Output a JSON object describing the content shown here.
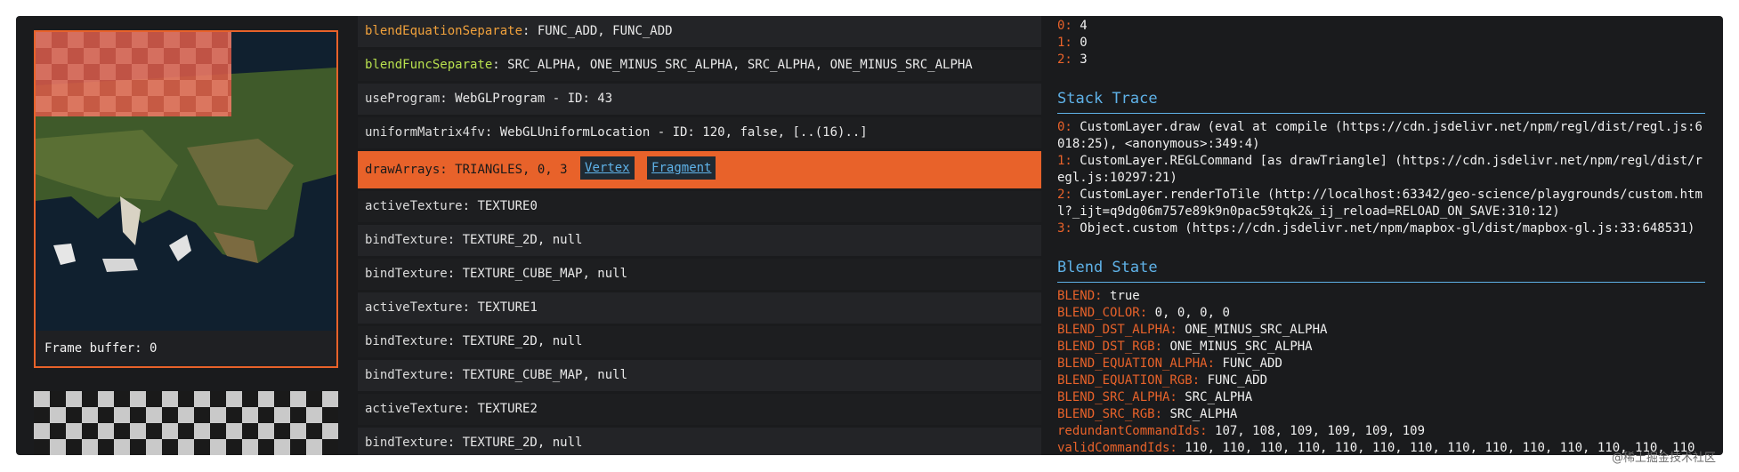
{
  "preview": {
    "framebuffer_label": "Frame buffer: 0"
  },
  "commands": [
    {
      "name": "blendEquationSeparate",
      "args": "FUNC_ADD, FUNC_ADD",
      "color": "orange"
    },
    {
      "name": "blendFuncSeparate",
      "args": "SRC_ALPHA, ONE_MINUS_SRC_ALPHA, SRC_ALPHA, ONE_MINUS_SRC_ALPHA",
      "color": "green"
    },
    {
      "name": "useProgram",
      "args": "WebGLProgram - ID: 43"
    },
    {
      "name": "uniformMatrix4fv",
      "args": "WebGLUniformLocation - ID: 120, false, [..(16)..]"
    },
    {
      "name": "drawArrays",
      "args": "TRIANGLES, 0, 3",
      "selected": true,
      "vertex_label": "Vertex",
      "fragment_label": "Fragment"
    },
    {
      "name": "activeTexture",
      "args": "TEXTURE0"
    },
    {
      "name": "bindTexture",
      "args": "TEXTURE_2D, null"
    },
    {
      "name": "bindTexture",
      "args": "TEXTURE_CUBE_MAP, null"
    },
    {
      "name": "activeTexture",
      "args": "TEXTURE1"
    },
    {
      "name": "bindTexture",
      "args": "TEXTURE_2D, null"
    },
    {
      "name": "bindTexture",
      "args": "TEXTURE_CUBE_MAP, null"
    },
    {
      "name": "activeTexture",
      "args": "TEXTURE2"
    },
    {
      "name": "bindTexture",
      "args": "TEXTURE_2D, null"
    }
  ],
  "info": {
    "top_list": [
      {
        "key": "0:",
        "value": "4"
      },
      {
        "key": "1:",
        "value": "0"
      },
      {
        "key": "2:",
        "value": "3"
      }
    ],
    "stack_trace_heading": "Stack Trace",
    "stack_trace": [
      {
        "key": "0:",
        "value": "CustomLayer.draw (eval at compile (https://cdn.jsdelivr.net/npm/regl/dist/regl.js:6"
      },
      {
        "key": "",
        "value": "018:25), <anonymous>:349:4)"
      },
      {
        "key": "1:",
        "value": "CustomLayer.REGLCommand [as drawTriangle] (https://cdn.jsdelivr.net/npm/regl/dist/r"
      },
      {
        "key": "",
        "value": "egl.js:10297:21)"
      },
      {
        "key": "2:",
        "value": "CustomLayer.renderToTile (http://localhost:63342/geo-science/playgrounds/custom.htm"
      },
      {
        "key": "",
        "value": "l?_ijt=q9dg06m757e89k9n0pac59tqk2&_ij_reload=RELOAD_ON_SAVE:310:12)"
      },
      {
        "key": "3:",
        "value": "Object.custom (https://cdn.jsdelivr.net/npm/mapbox-gl/dist/mapbox-gl.js:33:648531)"
      }
    ],
    "blend_state_heading": "Blend State",
    "blend_state": [
      {
        "key": "BLEND:",
        "value": "true"
      },
      {
        "key": "BLEND_COLOR:",
        "value": "0, 0, 0, 0"
      },
      {
        "key": "BLEND_DST_ALPHA:",
        "value": "ONE_MINUS_SRC_ALPHA"
      },
      {
        "key": "BLEND_DST_RGB:",
        "value": "ONE_MINUS_SRC_ALPHA"
      },
      {
        "key": "BLEND_EQUATION_ALPHA:",
        "value": "FUNC_ADD"
      },
      {
        "key": "BLEND_EQUATION_RGB:",
        "value": "FUNC_ADD"
      },
      {
        "key": "BLEND_SRC_ALPHA:",
        "value": "SRC_ALPHA"
      },
      {
        "key": "BLEND_SRC_RGB:",
        "value": "SRC_ALPHA"
      },
      {
        "key": "redundantCommandIds:",
        "value": "107, 108, 109, 109, 109, 109"
      },
      {
        "key": "validCommandIds:",
        "value": "110, 110, 110, 110, 110, 110, 110, 110, 110, 110, 110, 110, 110, 110"
      }
    ]
  },
  "watermark": "@稀土掘金技术社区",
  "colors": {
    "accent": "#e8622a",
    "heading": "#5fb2e8",
    "panel_bg": "#1a1b1d"
  }
}
